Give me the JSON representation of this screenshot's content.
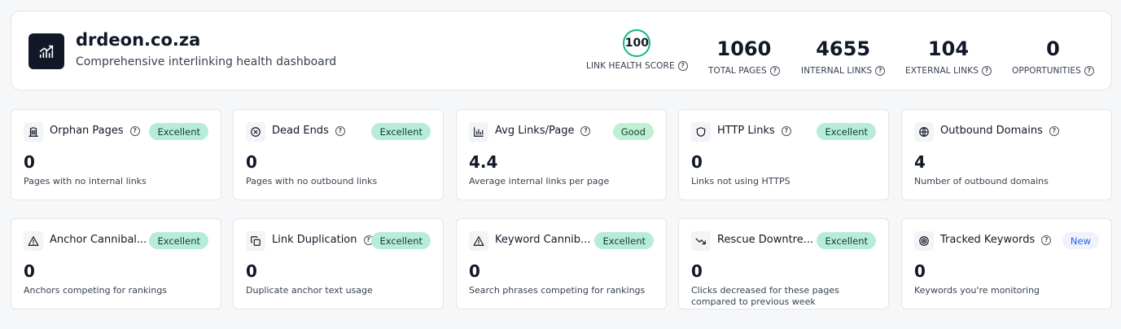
{
  "header": {
    "site_name": "drdeon.co.za",
    "subtitle": "Comprehensive interlinking health dashboard",
    "logo_icon": "chart-trend-icon",
    "stats": [
      {
        "value": "100",
        "label": "LINK HEALTH SCORE"
      },
      {
        "value": "1060",
        "label": "TOTAL PAGES"
      },
      {
        "value": "4655",
        "label": "INTERNAL LINKS"
      },
      {
        "value": "104",
        "label": "EXTERNAL LINKS"
      },
      {
        "value": "0",
        "label": "OPPORTUNITIES"
      }
    ],
    "help_glyph": "?"
  },
  "cards": [
    {
      "title": "Orphan Pages",
      "icon": "building-icon",
      "badge": "Excellent",
      "value": "0",
      "desc": "Pages with no internal links"
    },
    {
      "title": "Dead Ends",
      "icon": "x-circle-icon",
      "badge": "Excellent",
      "value": "0",
      "desc": "Pages with no outbound links"
    },
    {
      "title": "Avg Links/Page",
      "icon": "bar-chart-icon",
      "badge": "Good",
      "value": "4.4",
      "desc": "Average internal links per page"
    },
    {
      "title": "HTTP Links",
      "icon": "shield-icon",
      "badge": "Excellent",
      "value": "0",
      "desc": "Links not using HTTPS"
    },
    {
      "title": "Outbound Domains",
      "icon": "globe-icon",
      "badge": "",
      "value": "4",
      "desc": "Number of outbound domains"
    },
    {
      "title": "Anchor Cannibal...",
      "icon": "warning-icon",
      "badge": "Excellent",
      "value": "0",
      "desc": "Anchors competing for rankings"
    },
    {
      "title": "Link Duplication",
      "icon": "copy-icon",
      "badge": "Excellent",
      "value": "0",
      "desc": "Duplicate anchor text usage"
    },
    {
      "title": "Keyword Cannib...",
      "icon": "warning-icon",
      "badge": "Excellent",
      "value": "0",
      "desc": "Search phrases competing for rankings"
    },
    {
      "title": "Rescue Downtre...",
      "icon": "trend-down-icon",
      "badge": "Excellent",
      "value": "0",
      "desc": "Clicks decreased for these pages compared to previous week"
    },
    {
      "title": "Tracked Keywords",
      "icon": "target-icon",
      "badge": "New",
      "value": "0",
      "desc": "Keywords you're monitoring"
    }
  ],
  "colors": {
    "accent": "#10b981",
    "badge_excellent": "#b7ecdc",
    "badge_new_text": "#2563eb",
    "logo_bg": "#111827"
  }
}
